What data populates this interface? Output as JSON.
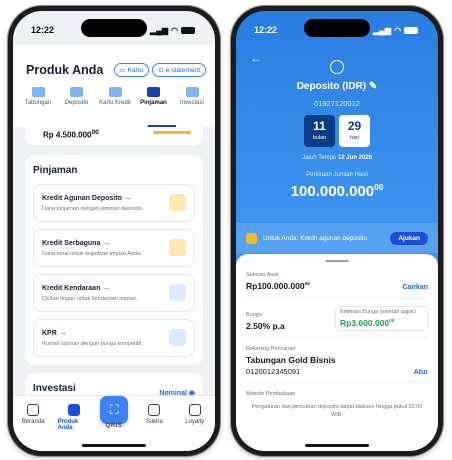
{
  "left": {
    "status_time": "12:22",
    "title": "Produk Anda",
    "kartu_label": "Kartu",
    "estatement_label": "e-statement",
    "tabs": [
      {
        "label": "Tabungan"
      },
      {
        "label": "Deposito"
      },
      {
        "label": "Kartu Kredit"
      },
      {
        "label": "Pinjaman"
      },
      {
        "label": "Investasi"
      }
    ],
    "top_amount": "Rp 4.500.000",
    "top_amount_suffix": "00",
    "pinjaman_title": "Pinjaman",
    "products": [
      {
        "name": "Kredit Agunan Deposito",
        "desc": "Dana pinjaman dengan jaminan deposito.",
        "icon": "safe-icon",
        "color": "#f5b82e"
      },
      {
        "name": "Kredit Serbaguna",
        "desc": "Dana tunai untuk wujudkan impian Anda.",
        "icon": "coins-icon",
        "color": "#f5b82e"
      },
      {
        "name": "Kredit Kendaraan",
        "desc": "Cicilan ringan untuk kendaraan impian.",
        "icon": "speedometer-icon",
        "color": "#3b82f6"
      },
      {
        "name": "KPR",
        "desc": "Rumah idaman dengan bunga kompetitif.",
        "icon": "house-percent-icon",
        "color": "#3b82f6"
      }
    ],
    "investasi_title": "Investasi",
    "nominal_label": "Nominal",
    "nav": [
      {
        "label": "Beranda",
        "icon": "home-icon"
      },
      {
        "label": "Produk Anda",
        "icon": "wallet-icon"
      },
      {
        "label": "QRIS",
        "icon": "qris-icon"
      },
      {
        "label": "Sukha",
        "icon": "gift-icon"
      },
      {
        "label": "Loyalty",
        "icon": "loyalty-icon"
      }
    ]
  },
  "right": {
    "status_time": "12:22",
    "deposit_title": "Deposito (IDR)",
    "account_number": "01927120012",
    "tenor_months": "11",
    "tenor_months_label": "bulan",
    "tenor_days": "29",
    "tenor_days_label": "hari",
    "maturity_label": "Jatuh Tempo",
    "maturity_date": "12 Jun 2026",
    "estimate_label": "Perkiraan Jumlah Hasil",
    "estimate_value": "100.000.000",
    "estimate_suffix": "00",
    "promo_text": "Untuk Anda: Kredit agunan deposito",
    "ajukan_label": "Ajukan",
    "setoran_label": "Setoran Awal",
    "setoran_value": "Rp100.000.000",
    "setoran_suffix": "00",
    "cairkan_label": "Cairkan",
    "bunga_label": "Bunga",
    "bunga_value": "2.50% p.a",
    "estimasi_label": "Estimasi Bunga (setelah pajak)",
    "estimasi_value": "Rp3.600.000",
    "estimasi_suffix": "00",
    "rekening_label": "Rekening Pencairan",
    "rekening_name": "Tabungan Gold Bisnis",
    "rekening_number": "0120012345091",
    "atur_label": "Atur",
    "metode_label": "Metode Pembukaan",
    "footer_text": "Pengaturan dan pencairan deposito dapat diakses hingga pukul 22.00 WIB."
  }
}
